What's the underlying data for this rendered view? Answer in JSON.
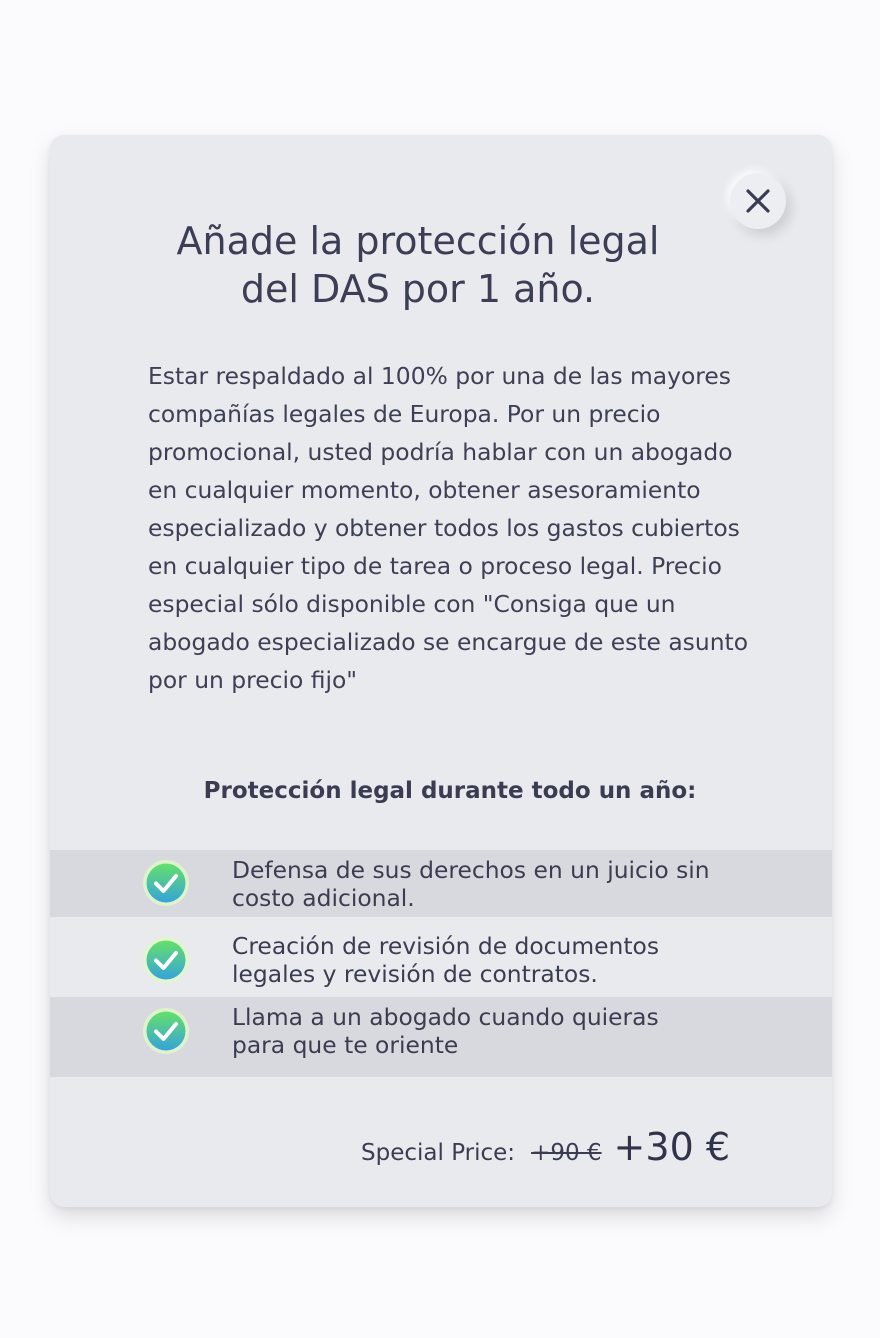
{
  "modal": {
    "title_line1": "Añade la protección legal",
    "title_line2": "del DAS por 1 año.",
    "description": "Estar respaldado al 100% por una de las mayores compañías legales de Europa. Por un precio promocional, usted podría hablar con un abogado en cualquier momento, obtener asesoramiento especializado y obtener todos los gastos cubiertos en cualquier tipo de tarea o proceso legal. Precio especial sólo disponible con \"Consiga que un abogado especializado se encargue de este asunto por un precio fijo\"",
    "subheading": "Protección legal durante todo un año:",
    "close_icon": "close-icon"
  },
  "benefits": [
    {
      "line1": "Defensa de sus derechos en un juicio sin",
      "line2": "costo adicional.",
      "icon": "check-circle-icon"
    },
    {
      "line1": "Creación de revisión de documentos",
      "line2": "legales y revisión de contratos.",
      "icon": "check-circle-icon"
    },
    {
      "line1": "Llama a un abogado cuando quieras",
      "line2": "para que te oriente",
      "icon": "check-circle-icon"
    }
  ],
  "price": {
    "label": "Special Price:",
    "old": "+90 €",
    "new": "+30 €"
  },
  "colors": {
    "card_background": "#e9eaee",
    "shaded_row": "#d8d9de",
    "text": "#3a3d52",
    "check_green": "#5bdc6a",
    "check_blue": "#3aa6d8"
  }
}
